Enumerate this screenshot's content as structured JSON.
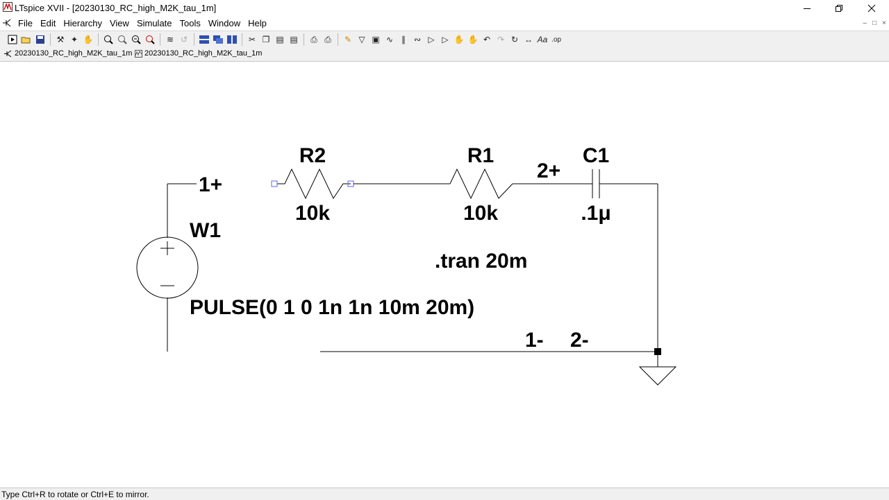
{
  "window": {
    "title": "LTspice XVII - [20230130_RC_high_M2K_tau_1m]"
  },
  "menu": [
    {
      "label": "File"
    },
    {
      "label": "Edit"
    },
    {
      "label": "Hierarchy"
    },
    {
      "label": "View"
    },
    {
      "label": "Simulate"
    },
    {
      "label": "Tools"
    },
    {
      "label": "Window"
    },
    {
      "label": "Help"
    }
  ],
  "tabs": [
    {
      "label": "20230130_RC_high_M2K_tau_1m",
      "icon": "schematic-icon"
    },
    {
      "label": "20230130_RC_high_M2K_tau_1m",
      "icon": "waveform-icon"
    }
  ],
  "toolbar": {
    "icons": [
      "run-icon",
      "open-icon",
      "save-icon",
      "control-panel-icon",
      "halt-icon",
      "pan-icon",
      "zoom-in-icon",
      "zoom-pan-icon",
      "zoom-out-icon",
      "zoom-fit-icon",
      "autorange-icon",
      "zoom-back-icon",
      "tile-horizontal-icon",
      "cascade-icon",
      "tile-vertical-icon",
      "cut-icon",
      "copy-icon",
      "paste-icon",
      "find-icon",
      "print-preview-icon",
      "print-icon",
      "draw-wire-icon",
      "ground-icon",
      "label-net-icon",
      "resistor-icon",
      "capacitor-icon",
      "inductor-icon",
      "diode-icon",
      "component-icon",
      "move-icon",
      "drag-icon",
      "undo-icon",
      "redo-icon",
      "rotate-icon",
      "mirror-icon",
      "text-icon",
      "spice-directive-icon"
    ]
  },
  "schematic": {
    "components": [
      {
        "ref": "R2",
        "value": "10k"
      },
      {
        "ref": "R1",
        "value": "10k"
      },
      {
        "ref": "C1",
        "value": ".1μ"
      },
      {
        "ref": "W1",
        "value": "PULSE(0 1 0 1n 1n 10m 20m)"
      }
    ],
    "net_labels": [
      "1+",
      "2+",
      "1-",
      "2-"
    ],
    "directive": ".tran 20m"
  },
  "status": {
    "text": "Type Ctrl+R to rotate or Ctrl+E to mirror."
  }
}
